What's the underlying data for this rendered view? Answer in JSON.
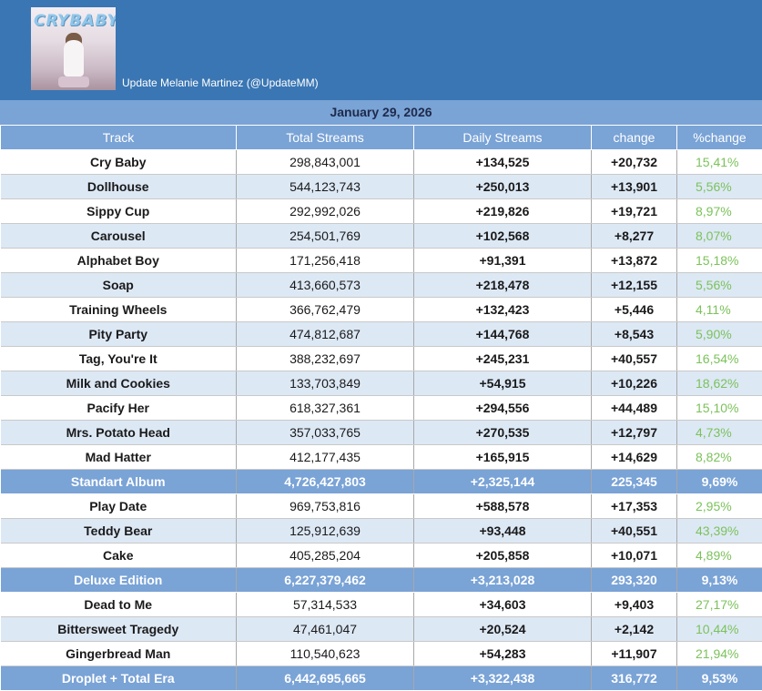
{
  "header": {
    "cover_text": "CRYBABY",
    "account": "Update Melanie Martinez (@UpdateMM)",
    "colors": {
      "header_bg": "#3a76b3",
      "table_header_bg": "#7aa3d6",
      "alt_row": "#dde8f5",
      "pct_green": "#7bc25a"
    }
  },
  "date": "January 29, 2026",
  "columns": [
    "Track",
    "Total Streams",
    "Daily Streams",
    "change",
    "%change"
  ],
  "rows": [
    {
      "type": "track",
      "name": "Cry Baby",
      "total": "298,843,001",
      "daily": "+134,525",
      "change": "+20,732",
      "pct": "15,41%"
    },
    {
      "type": "track",
      "name": "Dollhouse",
      "total": "544,123,743",
      "daily": "+250,013",
      "change": "+13,901",
      "pct": "5,56%"
    },
    {
      "type": "track",
      "name": "Sippy Cup",
      "total": "292,992,026",
      "daily": "+219,826",
      "change": "+19,721",
      "pct": "8,97%"
    },
    {
      "type": "track",
      "name": "Carousel",
      "total": "254,501,769",
      "daily": "+102,568",
      "change": "+8,277",
      "pct": "8,07%"
    },
    {
      "type": "track",
      "name": "Alphabet Boy",
      "total": "171,256,418",
      "daily": "+91,391",
      "change": "+13,872",
      "pct": "15,18%"
    },
    {
      "type": "track",
      "name": "Soap",
      "total": "413,660,573",
      "daily": "+218,478",
      "change": "+12,155",
      "pct": "5,56%"
    },
    {
      "type": "track",
      "name": "Training Wheels",
      "total": "366,762,479",
      "daily": "+132,423",
      "change": "+5,446",
      "pct": "4,11%"
    },
    {
      "type": "track",
      "name": "Pity Party",
      "total": "474,812,687",
      "daily": "+144,768",
      "change": "+8,543",
      "pct": "5,90%"
    },
    {
      "type": "track",
      "name": "Tag, You're It",
      "total": "388,232,697",
      "daily": "+245,231",
      "change": "+40,557",
      "pct": "16,54%"
    },
    {
      "type": "track",
      "name": "Milk and Cookies",
      "total": "133,703,849",
      "daily": "+54,915",
      "change": "+10,226",
      "pct": "18,62%"
    },
    {
      "type": "track",
      "name": "Pacify Her",
      "total": "618,327,361",
      "daily": "+294,556",
      "change": "+44,489",
      "pct": "15,10%"
    },
    {
      "type": "track",
      "name": "Mrs. Potato Head",
      "total": "357,033,765",
      "daily": "+270,535",
      "change": "+12,797",
      "pct": "4,73%"
    },
    {
      "type": "track",
      "name": "Mad Hatter",
      "total": "412,177,435",
      "daily": "+165,915",
      "change": "+14,629",
      "pct": "8,82%"
    },
    {
      "type": "summary",
      "name": "Standart Album",
      "total": "4,726,427,803",
      "daily": "+2,325,144",
      "change": "225,345",
      "pct": "9,69%"
    },
    {
      "type": "track",
      "name": "Play Date",
      "total": "969,753,816",
      "daily": "+588,578",
      "change": "+17,353",
      "pct": "2,95%"
    },
    {
      "type": "track",
      "name": "Teddy Bear",
      "total": "125,912,639",
      "daily": "+93,448",
      "change": "+40,551",
      "pct": "43,39%"
    },
    {
      "type": "track",
      "name": "Cake",
      "total": "405,285,204",
      "daily": "+205,858",
      "change": "+10,071",
      "pct": "4,89%"
    },
    {
      "type": "summary",
      "name": "Deluxe Edition",
      "total": "6,227,379,462",
      "daily": "+3,213,028",
      "change": "293,320",
      "pct": "9,13%"
    },
    {
      "type": "track",
      "name": "Dead to Me",
      "total": "57,314,533",
      "daily": "+34,603",
      "change": "+9,403",
      "pct": "27,17%"
    },
    {
      "type": "track",
      "name": "Bittersweet Tragedy",
      "total": "47,461,047",
      "daily": "+20,524",
      "change": "+2,142",
      "pct": "10,44%"
    },
    {
      "type": "track",
      "name": "Gingerbread Man",
      "total": "110,540,623",
      "daily": "+54,283",
      "change": "+11,907",
      "pct": "21,94%"
    },
    {
      "type": "summary",
      "name": "Droplet + Total Era",
      "total": "6,442,695,665",
      "daily": "+3,322,438",
      "change": "316,772",
      "pct": "9,53%"
    }
  ]
}
